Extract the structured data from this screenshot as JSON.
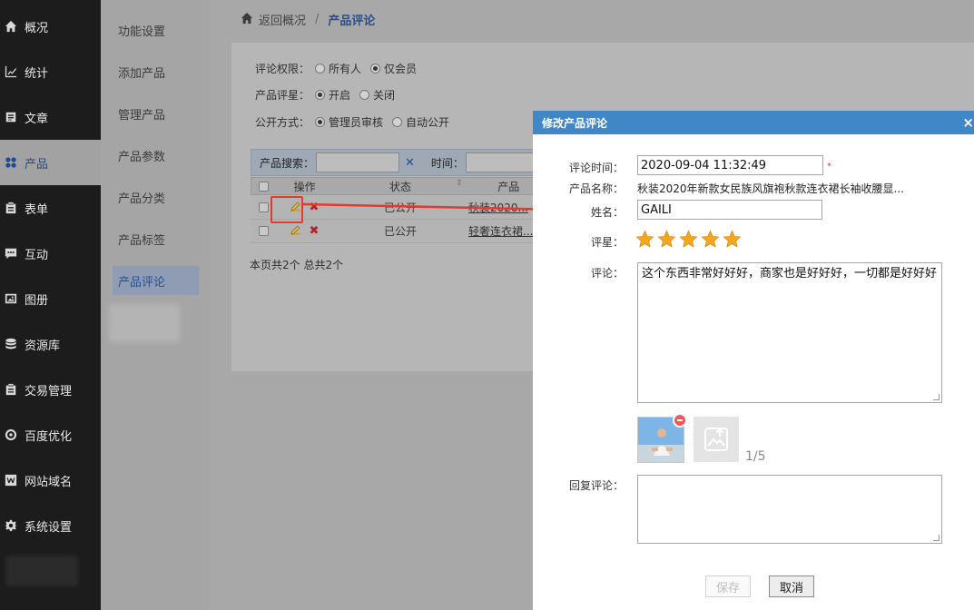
{
  "sidebar": {
    "items": [
      {
        "label": "概况",
        "icon": "home-icon"
      },
      {
        "label": "统计",
        "icon": "chart-icon"
      },
      {
        "label": "文章",
        "icon": "article-icon"
      },
      {
        "label": "产品",
        "icon": "product-icon"
      },
      {
        "label": "表单",
        "icon": "form-icon"
      },
      {
        "label": "互动",
        "icon": "chat-icon"
      },
      {
        "label": "图册",
        "icon": "album-icon"
      },
      {
        "label": "资源库",
        "icon": "database-icon"
      },
      {
        "label": "交易管理",
        "icon": "trade-icon"
      },
      {
        "label": "百度优化",
        "icon": "seo-icon"
      },
      {
        "label": "网站域名",
        "icon": "domain-icon"
      },
      {
        "label": "系统设置",
        "icon": "gear-icon"
      }
    ]
  },
  "submenu": {
    "items": [
      "功能设置",
      "添加产品",
      "管理产品",
      "产品参数",
      "产品分类",
      "产品标签",
      "产品评论"
    ]
  },
  "breadcrumb": {
    "back": "返回概况",
    "sep": "/",
    "current": "产品评论"
  },
  "settings": {
    "permission": {
      "label": "评论权限：",
      "options": [
        "所有人",
        "仅会员"
      ],
      "selected": 1
    },
    "rating": {
      "label": "产品评星：",
      "options": [
        "开启",
        "关闭"
      ],
      "selected": 0
    },
    "public": {
      "label": "公开方式：",
      "options": [
        "管理员审核",
        "自动公开"
      ],
      "selected": 0
    }
  },
  "table": {
    "search_label": "产品搜索：",
    "time_label": "时间：",
    "headers": [
      "操作",
      "状态",
      "产品"
    ],
    "rows": [
      {
        "status": "已公开",
        "product": "秋装2020..."
      },
      {
        "status": "已公开",
        "product": "轻奢连衣裙..."
      }
    ],
    "footer": "本页共2个 总共2个"
  },
  "modal": {
    "title": "修改产品评论",
    "close": "×",
    "time_label": "评论时间：",
    "time_value": "2020-09-04 11:32:49",
    "required_mark": "*",
    "product_label": "产品名称：",
    "product_value": "秋装2020年新款女民族风旗袍秋款连衣裙长袖收腰显...",
    "name_label": "姓名：",
    "name_value": "GAILI",
    "rating_label": "评星：",
    "rating_value": 5,
    "comment_label": "评论：",
    "comment_value": "这个东西非常好好好，商家也是好好好，一切都是好好好",
    "upload_count": "1/5",
    "reply_label": "回复评论：",
    "reply_value": "",
    "save": "保存",
    "cancel": "取消"
  },
  "colors": {
    "accent": "#3f87c7",
    "sidebar": "#1c1c1c",
    "star": "#f5a623",
    "highlight": "#e33a30"
  }
}
